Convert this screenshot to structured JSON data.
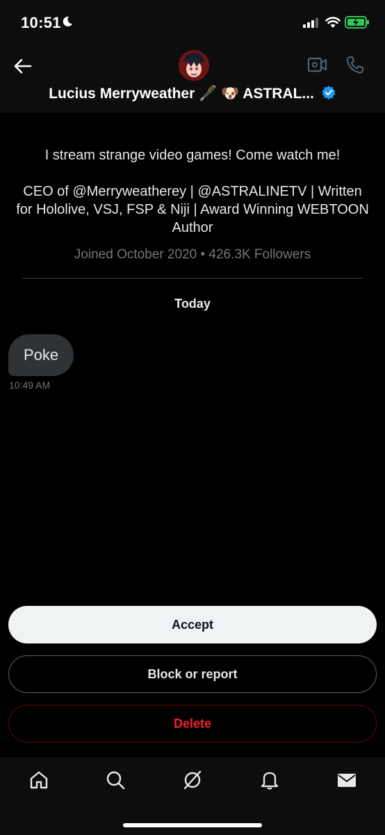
{
  "status_bar": {
    "time": "10:51"
  },
  "header": {
    "name": "Lucius Merryweather 🖋️ 🐶 ASTRAL...",
    "icons": [
      "back-arrow-icon",
      "avatar",
      "video-camera-icon",
      "phone-icon",
      "verified-badge-icon"
    ]
  },
  "profile": {
    "bio_line1": "I stream strange video games! Come watch me!",
    "bio_line2": "CEO of @Merryweatherey | @ASTRALINETV | Written for Hololive, VSJ, FSP & Niji | Award Winning WEBTOON Author",
    "meta": "Joined October 2020 • 426.3K Followers"
  },
  "conversation": {
    "day_label": "Today",
    "messages": [
      {
        "text": "Poke",
        "time": "10:49 AM"
      }
    ]
  },
  "actions": {
    "accept": "Accept",
    "block": "Block or report",
    "delete": "Delete"
  },
  "tabbar": {
    "icons": [
      "home-icon",
      "search-icon",
      "grok-icon",
      "bell-icon",
      "mail-icon"
    ]
  },
  "colors": {
    "background": "#000000",
    "accent_verified": "#1d9bf0",
    "danger": "#f4212e",
    "bubble": "#2f3336",
    "muted": "#71767b"
  }
}
